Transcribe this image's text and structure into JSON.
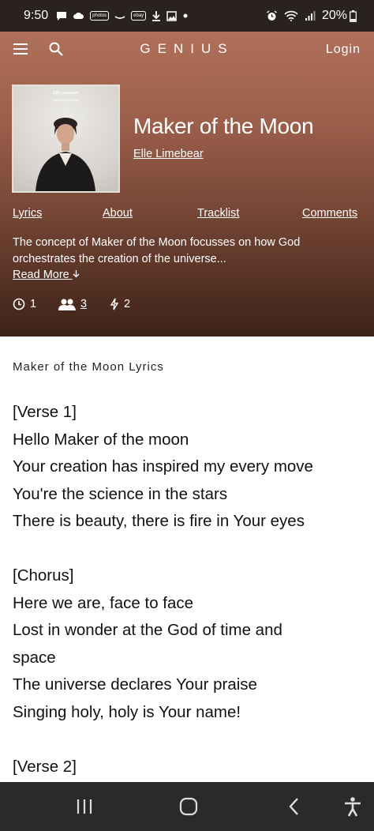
{
  "status_bar": {
    "time": "9:50",
    "tag_photos": "photos",
    "tag_ebay": "ebay",
    "battery": "20%",
    "icons": [
      "chat-icon",
      "cloud-icon",
      "photos-icon",
      "amazon-icon",
      "ebay-icon",
      "download-icon",
      "image-icon",
      "dot-icon",
      "alarm-icon",
      "wifi-icon",
      "signal-icon",
      "battery-icon"
    ]
  },
  "header": {
    "logo": "GENIUS",
    "login": "Login"
  },
  "album": {
    "cover_title": "Elle Limebear",
    "cover_subtitle": "Maker of the Moon",
    "title": "Maker of the Moon",
    "artist": "Elle Limebear"
  },
  "tabs": [
    {
      "label": "Lyrics"
    },
    {
      "label": "About"
    },
    {
      "label": "Tracklist"
    },
    {
      "label": "Comments"
    }
  ],
  "description": {
    "text": "The concept of Maker of the Moon focusses on how God orchestrates the creation of the universe...",
    "read_more": "Read More"
  },
  "stats": {
    "views": "1",
    "contributors": "3",
    "pyongs": "2"
  },
  "lyrics": {
    "heading": "Maker of the Moon Lyrics",
    "lines": [
      "[Verse 1]",
      "Hello Maker of the moon",
      "Your creation has inspired my every move",
      "You're the science in the stars",
      "There is beauty, there is fire in Your eyes",
      "",
      "[Chorus]",
      "Here we are, face to face",
      "Lost in wonder at the God of time and",
      "space",
      "The universe declares Your praise",
      "Singing holy, holy is Your name!",
      "",
      "[Verse 2]"
    ]
  },
  "colors": {
    "hero_top": "#b0705a",
    "hero_bottom": "#3c2218",
    "status_bar": "#2a221f",
    "nav_bar": "#2a2a2a"
  }
}
